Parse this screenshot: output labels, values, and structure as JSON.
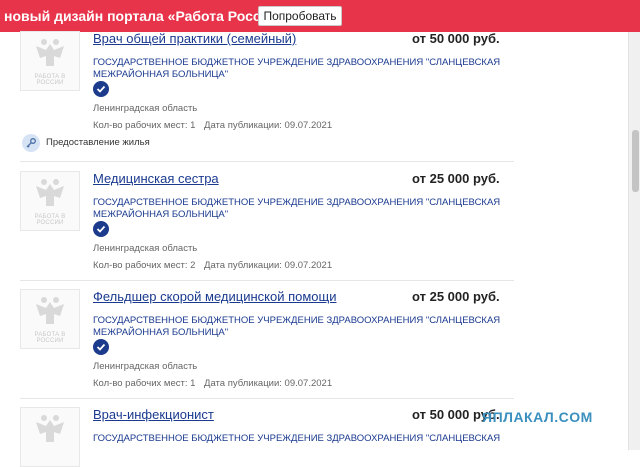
{
  "banner": {
    "text": "новый дизайн портала «Работа России»",
    "button_label": "Попробовать"
  },
  "logo_caption": "РАБОТА В РОССИИ",
  "vacancies": [
    {
      "title": "Врач общей практики (семейный)",
      "salary": "от 50 000 руб.",
      "employer": "ГОСУДАРСТВЕННОЕ БЮДЖЕТНОЕ УЧРЕЖДЕНИЕ ЗДРАВООХРАНЕНИЯ \"СЛАНЦЕВСКАЯ МЕЖРАЙОННАЯ БОЛЬНИЦА\"",
      "region": "Ленинградская область",
      "workplaces": "Кол-во рабочих мест: 1",
      "published": "Дата публикации: 09.07.2021"
    },
    {
      "title": "Медицинская сестра",
      "salary": "от 25 000 руб.",
      "employer": "ГОСУДАРСТВЕННОЕ БЮДЖЕТНОЕ УЧРЕЖДЕНИЕ ЗДРАВООХРАНЕНИЯ \"СЛАНЦЕВСКАЯ МЕЖРАЙОННАЯ БОЛЬНИЦА\"",
      "region": "Ленинградская область",
      "workplaces": "Кол-во рабочих мест: 2",
      "published": "Дата публикации: 09.07.2021"
    },
    {
      "title": "Фельдшер скорой медицинской помощи",
      "salary": "от 25 000 руб.",
      "employer": "ГОСУДАРСТВЕННОЕ БЮДЖЕТНОЕ УЧРЕЖДЕНИЕ ЗДРАВООХРАНЕНИЯ \"СЛАНЦЕВСКАЯ МЕЖРАЙОННАЯ БОЛЬНИЦА\"",
      "region": "Ленинградская область",
      "workplaces": "Кол-во рабочих мест: 1",
      "published": "Дата публикации: 09.07.2021"
    },
    {
      "title": "Врач-инфекционист",
      "salary": "от 50 000 руб.",
      "employer": "ГОСУДАРСТВЕННОЕ БЮДЖЕТНОЕ УЧРЕЖДЕНИЕ ЗДРАВООХРАНЕНИЯ \"СЛАНЦЕВСКАЯ"
    }
  ],
  "housing_label": "Предоставление жилья",
  "watermark": "ЯПЛАКАЛ.COM",
  "colors": {
    "banner": "#e8344b",
    "link": "#1a3a8f",
    "badge": "#1d3b8c"
  },
  "icons": {
    "verified": "check-circle-icon",
    "housing": "key-icon",
    "logo": "eagle-emblem-icon"
  }
}
